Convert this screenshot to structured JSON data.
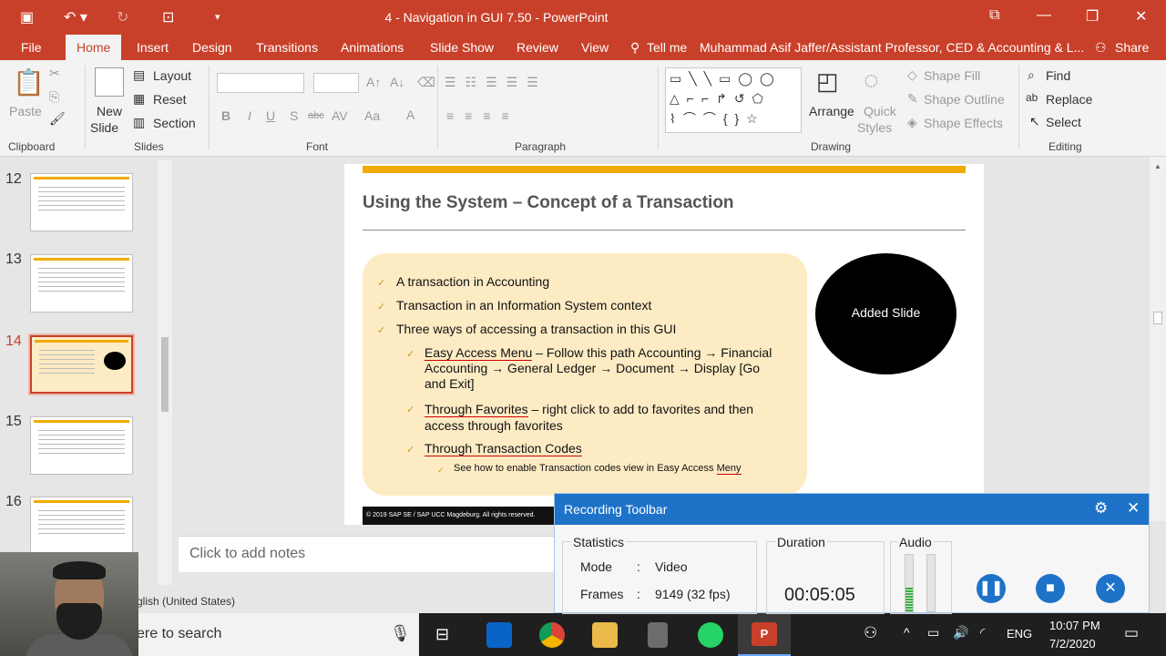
{
  "window": {
    "title": "4 - Navigation in GUI 7.50 - PowerPoint"
  },
  "ribbon": {
    "tabs": [
      {
        "label": "File"
      },
      {
        "label": "Home"
      },
      {
        "label": "Insert"
      },
      {
        "label": "Design"
      },
      {
        "label": "Transitions"
      },
      {
        "label": "Animations"
      },
      {
        "label": "Slide Show"
      },
      {
        "label": "Review"
      },
      {
        "label": "View"
      },
      {
        "label": "Tell me"
      }
    ],
    "user": "Muhammad Asif Jaffer/Assistant Professor, CED & Accounting & L...",
    "share": "Share",
    "clipboard": {
      "paste": "Paste",
      "label": "Clipboard"
    },
    "slides": {
      "new_slide_1": "New",
      "new_slide_2": "Slide",
      "layout": "Layout",
      "reset": "Reset",
      "section": "Section",
      "label": "Slides"
    },
    "font": {
      "label": "Font",
      "bold": "B",
      "italic": "I",
      "underline": "U",
      "shadow": "S",
      "strike": "abc",
      "spacing": "AV",
      "case": "Aa",
      "color": "A"
    },
    "paragraph": {
      "label": "Paragraph"
    },
    "drawing": {
      "label": "Drawing",
      "arrange": "Arrange",
      "quick_styles_1": "Quick",
      "quick_styles_2": "Styles",
      "shape_fill": "Shape Fill",
      "shape_outline": "Shape Outline",
      "shape_effects": "Shape Effects"
    },
    "editing": {
      "label": "Editing",
      "find": "Find",
      "replace": "Replace",
      "select": "Select"
    }
  },
  "thumbnails": [
    {
      "number": "12"
    },
    {
      "number": "13"
    },
    {
      "number": "14"
    },
    {
      "number": "15"
    },
    {
      "number": "16"
    }
  ],
  "slide": {
    "title": "Using the System – Concept of a Transaction",
    "bullets": [
      "A transaction in Accounting",
      "Transaction in an Information System context",
      "Three ways of accessing a transaction in this GUI"
    ],
    "sub1_link": "Easy Access Menu",
    "sub1_line1": " – Follow this path Accounting → Financial",
    "sub1_line2": "Accounting → General Ledger → Document → Display [Go",
    "sub1_line3": "and Exit]",
    "sub2_link": "Through Favorites",
    "sub2_line1": " – right click to add to favorites and then",
    "sub2_line2": "access through favorites",
    "sub3_link": "Through Transaction Codes",
    "sub3_note": "See how to enable Transaction codes view in Easy Access ",
    "sub3_note_end": "Meny",
    "oval_text": "Added Slide",
    "footer": "© 2019 SAP SE / SAP UCC Magdeburg. All rights reserved."
  },
  "notes": {
    "placeholder": "Click to add notes"
  },
  "status": {
    "language": "glish (United States)"
  },
  "taskbar": {
    "search": "ere to search",
    "lang": "ENG",
    "time": "10:07 PM",
    "date": "7/2/2020"
  },
  "recording": {
    "title": "Recording Toolbar",
    "statistics": "Statistics",
    "mode_label": "Mode",
    "mode_value": "Video",
    "frames_label": "Frames",
    "frames_value": "9149 (32 fps)",
    "colon": ":",
    "duration_label": "Duration",
    "duration_value": "00:05:05",
    "audio_label": "Audio"
  },
  "colors": {
    "accent": "#c9402a",
    "recording_blue": "#1e73c8",
    "slide_yellow": "#f0ab00"
  }
}
